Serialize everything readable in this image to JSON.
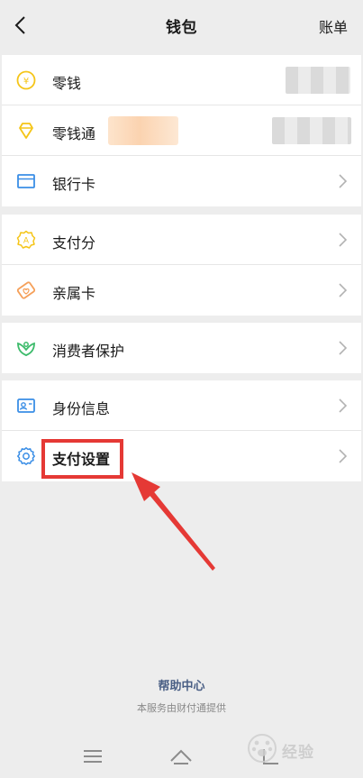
{
  "header": {
    "title": "钱包",
    "right_label": "账单"
  },
  "groups": [
    {
      "items": [
        {
          "label": "零钱",
          "icon": "coin-icon",
          "has_chevron": false,
          "value": "blurred"
        },
        {
          "label": "零钱通",
          "icon": "diamond-icon",
          "has_chevron": false,
          "value": "blurred"
        },
        {
          "label": "银行卡",
          "icon": "bank-card-icon",
          "has_chevron": true
        }
      ]
    },
    {
      "items": [
        {
          "label": "支付分",
          "icon": "pay-score-icon",
          "has_chevron": true
        },
        {
          "label": "亲属卡",
          "icon": "family-card-icon",
          "has_chevron": true
        }
      ]
    },
    {
      "items": [
        {
          "label": "消费者保护",
          "icon": "consumer-protection-icon",
          "has_chevron": true
        }
      ]
    },
    {
      "items": [
        {
          "label": "身份信息",
          "icon": "id-card-icon",
          "has_chevron": true
        },
        {
          "label": "支付设置",
          "icon": "gear-icon",
          "has_chevron": true
        }
      ]
    }
  ],
  "footer": {
    "help_link": "帮助中心",
    "note": "本服务由财付通提供"
  },
  "navbar": {
    "items": [
      "menu-icon",
      "home-icon",
      "back-icon"
    ]
  },
  "colors": {
    "accent_yellow": "#f5c518",
    "accent_blue": "#3a8ee6",
    "accent_green": "#3dbb6b",
    "accent_orange": "#f5a05a",
    "highlight_red": "#e53935",
    "link_blue": "#4a5f85"
  }
}
